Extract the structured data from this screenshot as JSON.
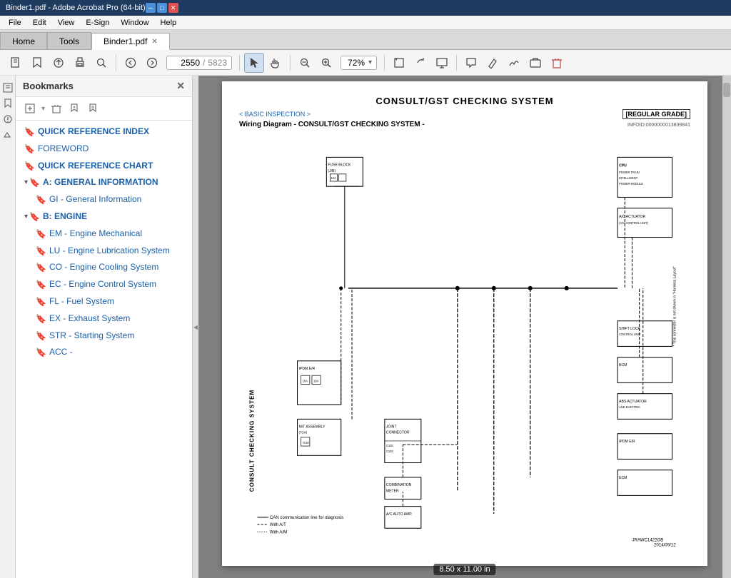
{
  "titleBar": {
    "title": "Binder1.pdf - Adobe Acrobat Pro (64-bit)",
    "minBtn": "─",
    "maxBtn": "□",
    "closeBtn": "✕"
  },
  "menuBar": {
    "items": [
      "File",
      "Edit",
      "View",
      "E-Sign",
      "Window",
      "Help"
    ]
  },
  "tabs": [
    {
      "id": "home",
      "label": "Home",
      "active": false,
      "closeable": false
    },
    {
      "id": "tools",
      "label": "Tools",
      "active": false,
      "closeable": false
    },
    {
      "id": "binder",
      "label": "Binder1.pdf",
      "active": true,
      "closeable": true
    }
  ],
  "toolbar": {
    "currentPage": "2550",
    "totalPages": "5823",
    "zoomLevel": "72%"
  },
  "sidebar": {
    "title": "Bookmarks",
    "tree": [
      {
        "id": "qri",
        "label": "QUICK REFERENCE INDEX",
        "type": "bookmark",
        "level": 0,
        "expanded": false
      },
      {
        "id": "fw",
        "label": "FOREWORD",
        "type": "bookmark",
        "level": 0,
        "expanded": false
      },
      {
        "id": "qrc",
        "label": "QUICK REFERENCE CHART",
        "type": "bookmark",
        "level": 0,
        "expanded": false
      },
      {
        "id": "a",
        "label": "A: GENERAL INFORMATION",
        "type": "folder",
        "level": 0,
        "expanded": true
      },
      {
        "id": "gi",
        "label": "GI - General Information",
        "type": "bookmark",
        "level": 1,
        "expanded": false
      },
      {
        "id": "b",
        "label": "B: ENGINE",
        "type": "folder",
        "level": 0,
        "expanded": true
      },
      {
        "id": "em",
        "label": "EM - Engine Mechanical",
        "type": "bookmark",
        "level": 1,
        "expanded": false
      },
      {
        "id": "lu",
        "label": "LU - Engine Lubrication System",
        "type": "bookmark",
        "level": 1,
        "expanded": false
      },
      {
        "id": "co",
        "label": "CO - Engine Cooling System",
        "type": "bookmark",
        "level": 1,
        "expanded": false
      },
      {
        "id": "ec",
        "label": "EC - Engine Control System",
        "type": "bookmark",
        "level": 1,
        "expanded": false
      },
      {
        "id": "fl",
        "label": "FL - Fuel System",
        "type": "bookmark",
        "level": 1,
        "expanded": false
      },
      {
        "id": "ex",
        "label": "EX - Exhaust System",
        "type": "bookmark",
        "level": 1,
        "expanded": false
      },
      {
        "id": "str",
        "label": "STR - Starting System",
        "type": "bookmark",
        "level": 1,
        "expanded": false
      },
      {
        "id": "acc",
        "label": "ACC -",
        "type": "bookmark",
        "level": 1,
        "expanded": false
      }
    ]
  },
  "pdf": {
    "title": "CONSULT/GST CHECKING SYSTEM",
    "navLeft": "< BASIC INSPECTION >",
    "grade": "[REGULAR GRADE]",
    "subtitle": "Wiring Diagram - CONSULT/GST CHECKING SYSTEM -",
    "subtitleRef": "INFOID:0000000013839841",
    "pageSize": "8.50 x 11.00 in"
  }
}
